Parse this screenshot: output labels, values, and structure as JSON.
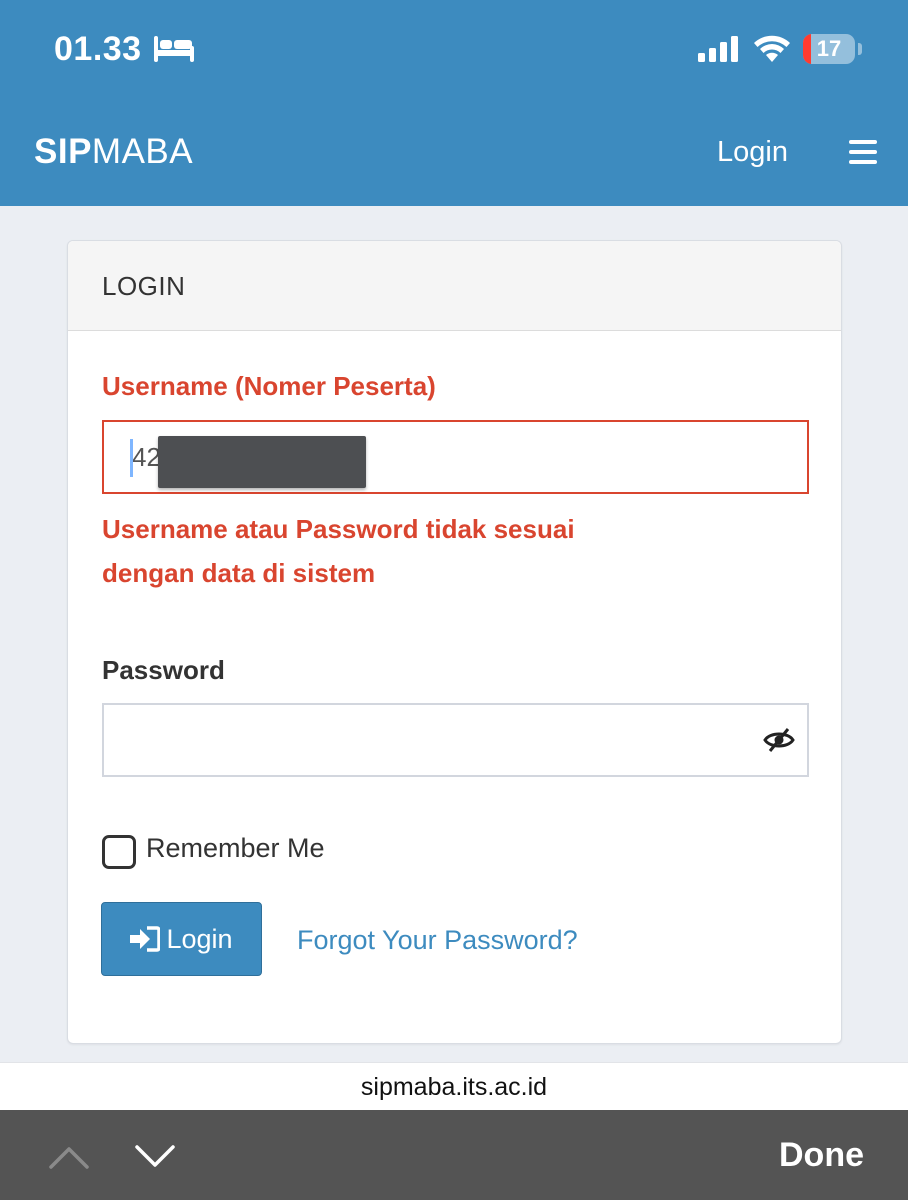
{
  "status_bar": {
    "time": "01.33",
    "battery": "17",
    "icons": [
      "bed-icon",
      "signal-icon",
      "wifi-icon",
      "battery-icon"
    ]
  },
  "navbar": {
    "brand_bold": "SIP",
    "brand_light": "MABA",
    "login_link": "Login",
    "menu_icon": "hamburger-icon"
  },
  "panel": {
    "heading": "LOGIN",
    "username_label": "Username (Nomer Peserta)",
    "username_value": "42",
    "error_message": "Username atau Password tidak sesuai dengan data di sistem",
    "password_label": "Password",
    "password_value": "",
    "password_toggle_icon": "eye-slash-icon",
    "remember_label": "Remember Me",
    "remember_checked": false,
    "login_button": "Login",
    "login_button_icon": "sign-in-icon",
    "forgot_link": "Forgot Your Password?"
  },
  "browser": {
    "url": "sipmaba.its.ac.id",
    "done_label": "Done"
  },
  "colors": {
    "primary": "#3d8bbf",
    "error": "#d9452f",
    "toolbar": "#545454"
  }
}
